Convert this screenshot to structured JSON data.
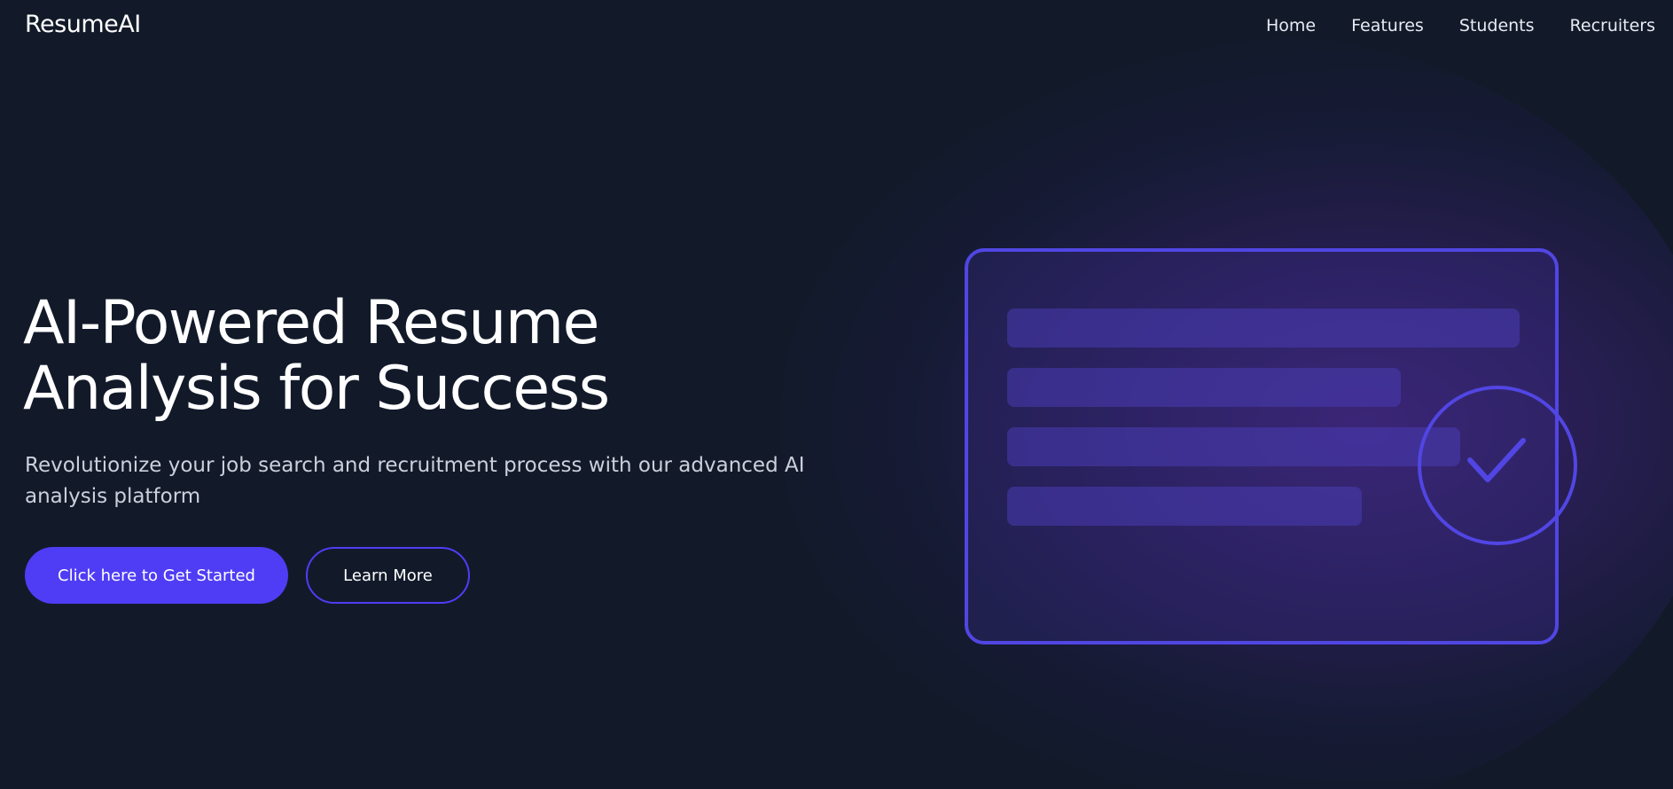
{
  "header": {
    "brand": "ResumeAI",
    "nav": [
      {
        "label": "Home"
      },
      {
        "label": "Features"
      },
      {
        "label": "Students"
      },
      {
        "label": "Recruiters"
      }
    ]
  },
  "hero": {
    "title_line1": "AI-Powered Resume",
    "title_line2": "Analysis for Success",
    "subtitle": "Revolutionize your job search and recruitment process with our advanced AI analysis platform",
    "primary_button": "Click here to Get Started",
    "secondary_button": "Learn More"
  },
  "illustration": {
    "icon": "check-icon",
    "accent_color": "#5146e3",
    "button_color": "#4f3df5",
    "background_color": "#121a2a"
  }
}
